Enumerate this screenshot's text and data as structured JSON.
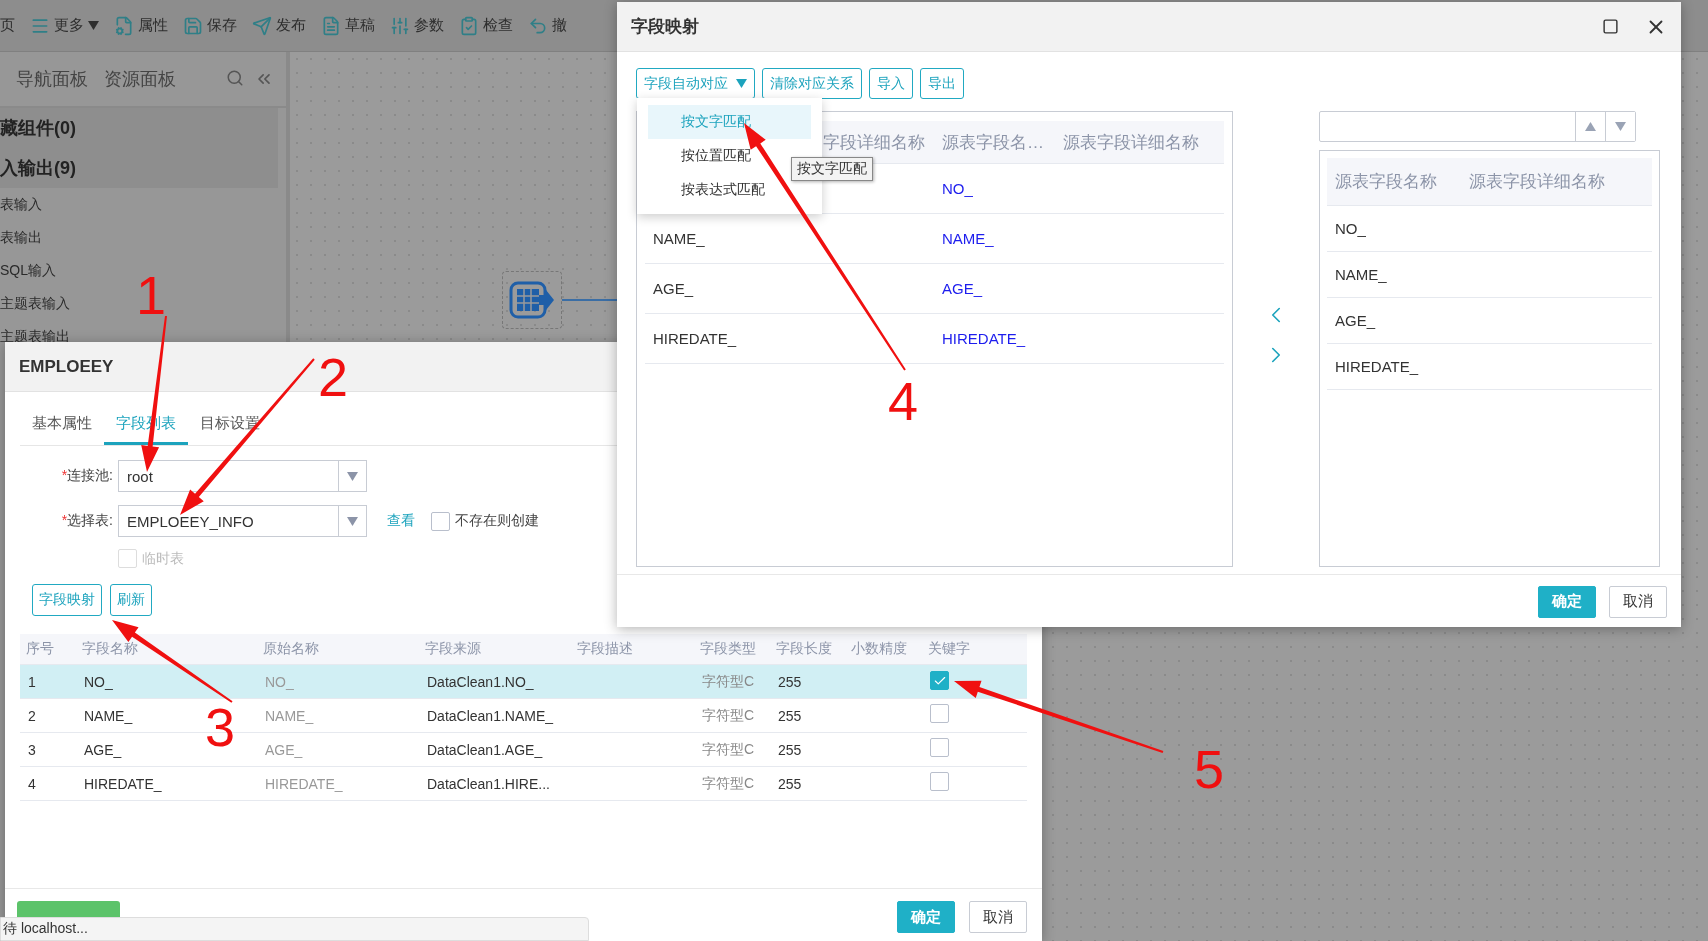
{
  "app": {
    "toolbar": [
      {
        "label": "页",
        "kind": "text"
      },
      {
        "label": "更多",
        "kind": "menu"
      },
      {
        "label": "属性",
        "kind": "props"
      },
      {
        "label": "保存",
        "kind": "save"
      },
      {
        "label": "发布",
        "kind": "publish"
      },
      {
        "label": "草稿",
        "kind": "draft"
      },
      {
        "label": "参数",
        "kind": "params"
      },
      {
        "label": "检查",
        "kind": "check"
      },
      {
        "label": "撤",
        "kind": "undo"
      }
    ],
    "panel": {
      "tabs": [
        {
          "label": "导航面板",
          "selected": false
        },
        {
          "label": "资源面板",
          "selected": false
        }
      ],
      "groups": [
        {
          "label": "藏组件(0)"
        },
        {
          "label": "入输出(9)",
          "children": [
            {
              "label": "表输入"
            },
            {
              "label": "表输出"
            },
            {
              "label": "SQL输入"
            },
            {
              "label": "主题表输入"
            },
            {
              "label": "主题表输出"
            }
          ]
        }
      ]
    }
  },
  "table_dialog": {
    "title": "EMPLOEEY",
    "tabs": [
      {
        "label": "基本属性",
        "selected": false
      },
      {
        "label": "字段列表",
        "selected": true
      },
      {
        "label": "目标设置",
        "selected": false
      }
    ],
    "fields": [
      {
        "marker": "*",
        "label": "连接池:",
        "value": "root"
      },
      {
        "marker": "*",
        "label": "选择表:",
        "value": "EMPLOEEY_INFO",
        "link": "查看",
        "option": {
          "label": "不存在则创建",
          "checked": false
        }
      }
    ],
    "temp_table": {
      "label": "临时表",
      "checked": false,
      "disabled": true
    },
    "actions": [
      {
        "label": "字段映射"
      },
      {
        "label": "刷新"
      }
    ],
    "table": {
      "columns": [
        "序号",
        "字段名称",
        "原始名称",
        "字段来源",
        "字段描述",
        "字段类型",
        "字段长度",
        "小数精度",
        "关键字"
      ],
      "rows": [
        {
          "index": "1",
          "name": "NO_",
          "original": "NO_",
          "source": "DataClean1.NO_",
          "type": "字符型C",
          "length": "255",
          "key": true,
          "selected": true
        },
        {
          "index": "2",
          "name": "NAME_",
          "original": "NAME_",
          "source": "DataClean1.NAME_",
          "type": "字符型C",
          "length": "255",
          "key": false,
          "selected": false
        },
        {
          "index": "3",
          "name": "AGE_",
          "original": "AGE_",
          "source": "DataClean1.AGE_",
          "type": "字符型C",
          "length": "255",
          "key": false,
          "selected": false
        },
        {
          "index": "4",
          "name": "HIREDATE_",
          "original": "HIREDATE_",
          "source": "DataClean1.HIRE...",
          "type": "字符型C",
          "length": "255",
          "key": false,
          "selected": false
        }
      ]
    },
    "buttons": [
      {
        "label": "确定",
        "kind": "primary"
      },
      {
        "label": "取消",
        "kind": "default"
      }
    ]
  },
  "mapping_dialog": {
    "title": "字段映射",
    "toolbar": [
      {
        "label": "字段自动对应",
        "kind": "dropdown"
      },
      {
        "label": "清除对应关系",
        "kind": "button"
      },
      {
        "label": "导入",
        "kind": "button"
      },
      {
        "label": "导出",
        "kind": "button"
      }
    ],
    "menu": [
      {
        "label": "按文字匹配",
        "selected": true
      },
      {
        "label": "按位置匹配",
        "selected": false
      },
      {
        "label": "按表达式匹配",
        "selected": false
      }
    ],
    "tooltip": "按文字匹配",
    "target_table": {
      "header": {
        "column_2": "字段详细名称",
        "column_3": "源表字段名…",
        "column_4": "源表字段详细名称"
      },
      "rows": [
        {
          "column_3": "NO_"
        },
        {
          "column_1": "NAME_",
          "column_3": "NAME_"
        },
        {
          "column_1": "AGE_",
          "column_3": "AGE_"
        },
        {
          "column_1": "HIREDATE_",
          "column_3": "HIREDATE_"
        }
      ]
    },
    "source_table": {
      "columns": [
        "源表字段名称",
        "源表字段详细名称"
      ],
      "rows": [
        "NO_",
        "NAME_",
        "AGE_",
        "HIREDATE_"
      ]
    },
    "buttons": [
      {
        "label": "确定",
        "kind": "primary"
      },
      {
        "label": "取消",
        "kind": "default"
      }
    ]
  },
  "status_bar": "待 localhost...",
  "annotations": [
    {
      "label": "1"
    },
    {
      "label": "2"
    },
    {
      "label": "3"
    },
    {
      "label": "4"
    },
    {
      "label": "5"
    }
  ]
}
